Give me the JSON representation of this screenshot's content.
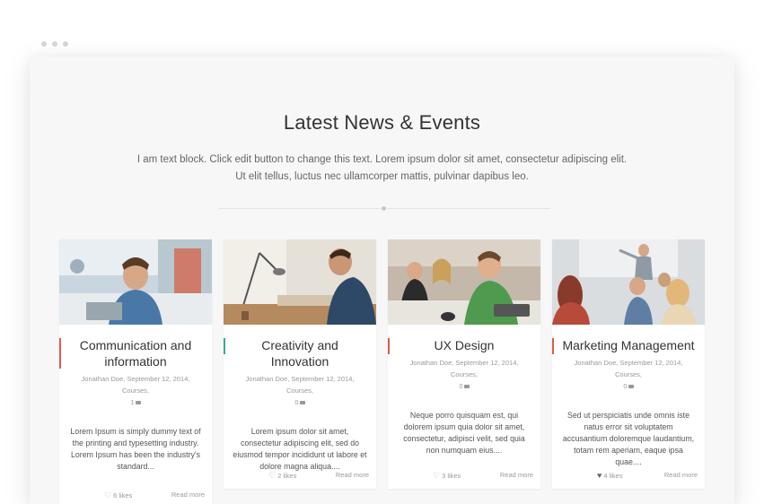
{
  "header": {
    "title": "Latest News & Events",
    "description_line1": "I am text block. Click edit button to change this text. Lorem ipsum dolor sit amet, consectetur adipiscing elit.",
    "description_line2": "Ut elit tellus, luctus nec ullamcorper mattis, pulvinar dapibus leo."
  },
  "colors": {
    "accent_red": "#e05a4b",
    "accent_teal": "#38a99a"
  },
  "cards": [
    {
      "title_line1": "Communication and",
      "title_line2": "information",
      "meta_line1": "Jonathan Doe, September 12, 2014, Courses,",
      "comments": "1",
      "excerpt": "Lorem Ipsum is simply dummy text of the printing and typesetting industry. Lorem Ipsum has been the industry's standard...",
      "likes": "6 likes",
      "read_more": "Read more",
      "accent": "#e05a4b"
    },
    {
      "title_line1": "Creativity and Innovation",
      "meta_line1": "Jonathan Doe, September 12, 2014, Courses,",
      "comments": "0",
      "excerpt": "Lorem ipsum dolor sit amet, consectetur adipiscing elit, sed do eiusmod tempor incididunt ut labore et dolore magna aliqua....",
      "likes": "2 likes",
      "read_more": "Read more",
      "accent": "#38a99a"
    },
    {
      "title_line1": "UX Design",
      "meta_line1": "Jonathan Doe, September 12, 2014, Courses,",
      "comments": "0",
      "excerpt": "Neque porro quisquam est, qui dolorem ipsum quia dolor sit amet, consectetur, adipisci velit, sed quia non numquam eius....",
      "likes": "3 likes",
      "read_more": "Read more",
      "accent": "#e05a4b"
    },
    {
      "title_line1": "Marketing Management",
      "meta_line1": "Jonathan Doe, September 12, 2014, Courses,",
      "comments": "0",
      "excerpt": "Sed ut perspiciatis unde omnis iste natus error sit voluptatem accusantium doloremque laudantium, totam rem aperiam, eaque ipsa quae....",
      "likes": "4 likes",
      "read_more": "Read more",
      "accent": "#e05a4b"
    }
  ]
}
